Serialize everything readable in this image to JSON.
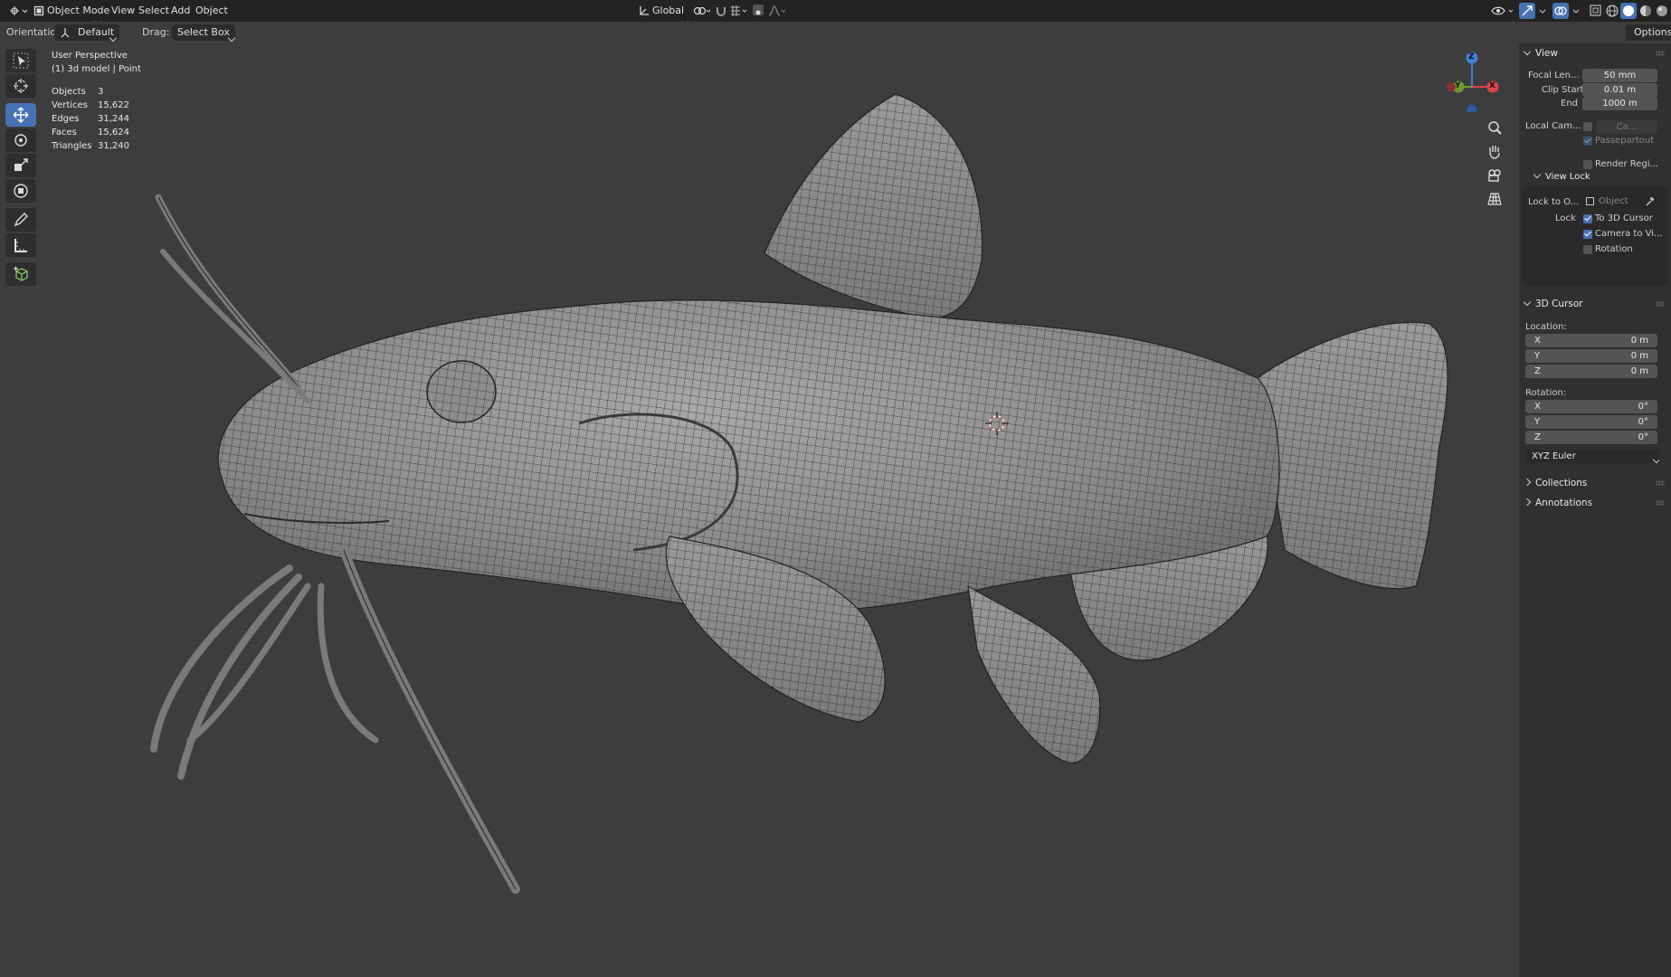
{
  "header": {
    "mode": "Object Mode",
    "menus": [
      "View",
      "Select",
      "Add",
      "Object"
    ],
    "transform_orientation": "Global",
    "options_label": "Options"
  },
  "tool_header": {
    "orientation_label": "Orientation:",
    "orientation_value": "Default",
    "drag_label": "Drag:",
    "drag_value": "Select Box"
  },
  "viewport": {
    "perspective": "User Perspective",
    "object_info": "(1) 3d model | Point",
    "stats": [
      {
        "label": "Objects",
        "value": "3"
      },
      {
        "label": "Vertices",
        "value": "15,622"
      },
      {
        "label": "Edges",
        "value": "31,244"
      },
      {
        "label": "Faces",
        "value": "15,624"
      },
      {
        "label": "Triangles",
        "value": "31,240"
      }
    ],
    "gizmo_axes": {
      "z": "Z",
      "y": "Y",
      "x": "X"
    },
    "axis_colors": {
      "x": "#e0424d",
      "y": "#6d9c2c",
      "z": "#3f7fd6"
    }
  },
  "sidebar": {
    "view_panel": {
      "title": "View",
      "focal_length_label": "Focal Len...",
      "focal_length": "50 mm",
      "clip_start_label": "Clip Start",
      "clip_start": "0.01 m",
      "end_label": "End",
      "end": "1000 m",
      "local_camera_label": "Local Cam...",
      "local_camera_value": "Ca...",
      "passepartout": "Passepartout",
      "render_region": "Render Regi..."
    },
    "view_lock": {
      "title": "View Lock",
      "lock_to_object_label": "Lock to O...",
      "lock_to_object_placeholder": "Object",
      "lock_label": "Lock",
      "to_3d_cursor": "To 3D Cursor",
      "camera_to_view": "Camera to Vi...",
      "rotation": "Rotation"
    },
    "cursor_panel": {
      "title": "3D Cursor",
      "location_label": "Location:",
      "location": [
        {
          "axis": "X",
          "value": "0 m"
        },
        {
          "axis": "Y",
          "value": "0 m"
        },
        {
          "axis": "Z",
          "value": "0 m"
        }
      ],
      "rotation_label": "Rotation:",
      "rotation": [
        {
          "axis": "X",
          "value": "0°"
        },
        {
          "axis": "Y",
          "value": "0°"
        },
        {
          "axis": "Z",
          "value": "0°"
        }
      ],
      "rotation_mode": "XYZ Euler"
    },
    "collections": "Collections",
    "annotations": "Annotations"
  },
  "colors": {
    "accent": "#4772b3",
    "header_bg": "#232323",
    "viewport_bg": "#3d3d3d",
    "sidebar_bg": "#303030"
  }
}
